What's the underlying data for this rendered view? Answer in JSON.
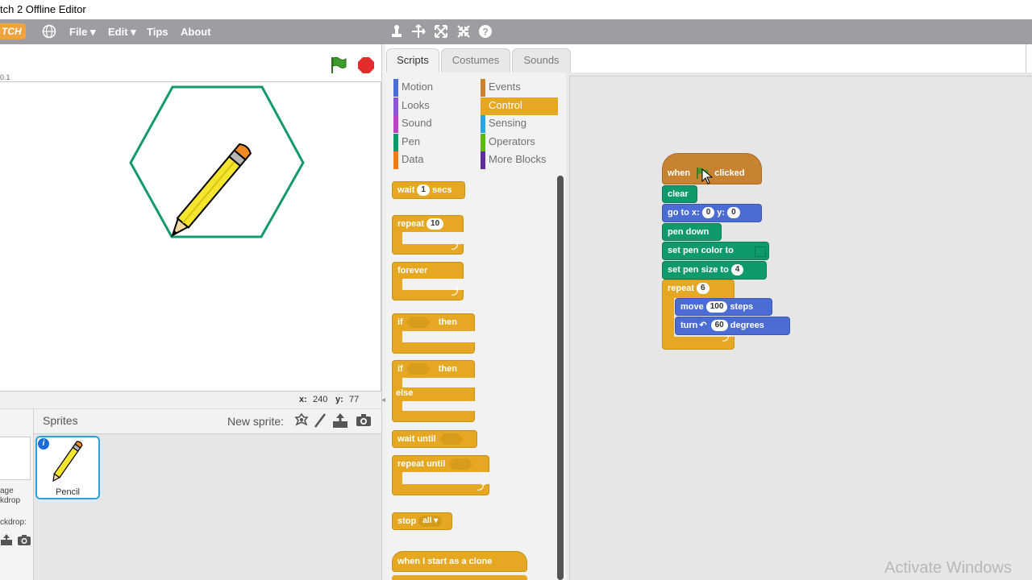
{
  "window": {
    "title": "tch 2 Offline Editor"
  },
  "menubar": {
    "logo": "TCH",
    "items": [
      "File ▾",
      "Edit ▾",
      "Tips",
      "About"
    ]
  },
  "stage": {
    "version": "0.1",
    "coords": {
      "x_label": "x:",
      "x": "240",
      "y_label": "y:",
      "y": "77"
    }
  },
  "sprites": {
    "header": "Sprites",
    "new_sprite_label": "New sprite:",
    "items": [
      {
        "name": "Pencil"
      }
    ],
    "stage_col": {
      "line1": "age",
      "line2": "kdrop",
      "line3": "ckdrop:"
    }
  },
  "tabs": [
    "Scripts",
    "Costumes",
    "Sounds"
  ],
  "categories": {
    "left": [
      {
        "label": "Motion",
        "color": "#4a6cd4"
      },
      {
        "label": "Looks",
        "color": "#8a55d7"
      },
      {
        "label": "Sound",
        "color": "#bb42c3"
      },
      {
        "label": "Pen",
        "color": "#0e9a6c"
      },
      {
        "label": "Data",
        "color": "#ee7d16"
      }
    ],
    "right": [
      {
        "label": "Events",
        "color": "#c88330"
      },
      {
        "label": "Control",
        "color": "#e6a823"
      },
      {
        "label": "Sensing",
        "color": "#2ca5e2"
      },
      {
        "label": "Operators",
        "color": "#5cb712"
      },
      {
        "label": "More Blocks",
        "color": "#632d99"
      }
    ]
  },
  "palette": {
    "wait": "wait",
    "wait_val": "1",
    "wait_unit": "secs",
    "repeat": "repeat",
    "repeat_val": "10",
    "forever": "forever",
    "if": "if",
    "then": "then",
    "else": "else",
    "wait_until": "wait until",
    "repeat_until": "repeat until",
    "stop": "stop",
    "stop_val": "all ▾",
    "clone": "when I start as a clone"
  },
  "script": {
    "when": "when",
    "clicked": "clicked",
    "clear": "clear",
    "goto": "go to x:",
    "goto_x": "0",
    "goto_y_label": "y:",
    "goto_y": "0",
    "pen_down": "pen down",
    "set_color": "set pen color to",
    "set_size": "set pen size to",
    "size_val": "4",
    "repeat": "repeat",
    "repeat_val": "6",
    "move": "move",
    "move_val": "100",
    "move_unit": "steps",
    "turn": "turn",
    "turn_val": "60",
    "turn_unit": "degrees"
  },
  "watermark": "Activate Windows"
}
